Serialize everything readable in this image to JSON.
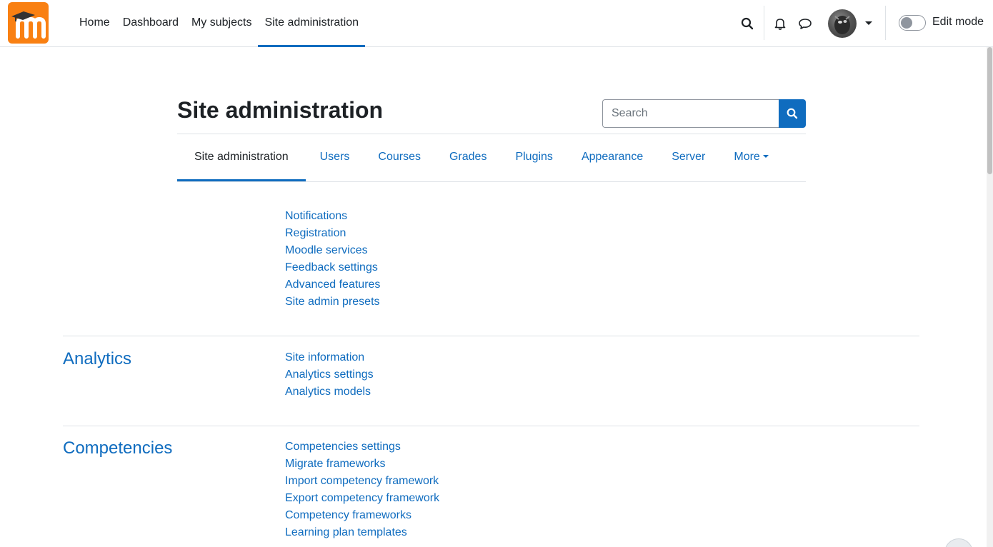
{
  "navbar": {
    "logo_alt": "Moodle",
    "items": [
      {
        "label": "Home"
      },
      {
        "label": "Dashboard"
      },
      {
        "label": "My subjects"
      },
      {
        "label": "Site administration"
      }
    ],
    "edit_mode_label": "Edit mode",
    "edit_mode_on": false
  },
  "page": {
    "title": "Site administration",
    "search_placeholder": "Search"
  },
  "tabs": [
    {
      "label": "Site administration"
    },
    {
      "label": "Users"
    },
    {
      "label": "Courses"
    },
    {
      "label": "Grades"
    },
    {
      "label": "Plugins"
    },
    {
      "label": "Appearance"
    },
    {
      "label": "Server"
    },
    {
      "label": "More"
    }
  ],
  "sections": [
    {
      "heading": "",
      "links": [
        "Notifications",
        "Registration",
        "Moodle services",
        "Feedback settings",
        "Advanced features",
        "Site admin presets"
      ]
    },
    {
      "heading": "Analytics",
      "links": [
        "Site information",
        "Analytics settings",
        "Analytics models"
      ]
    },
    {
      "heading": "Competencies",
      "links": [
        "Competencies settings",
        "Migrate frameworks",
        "Import competency framework",
        "Export competency framework",
        "Competency frameworks",
        "Learning plan templates"
      ]
    }
  ],
  "colors": {
    "brand": "#f98012",
    "link": "#0f6cbf",
    "text": "#1d2125",
    "border": "#dee2e6"
  }
}
